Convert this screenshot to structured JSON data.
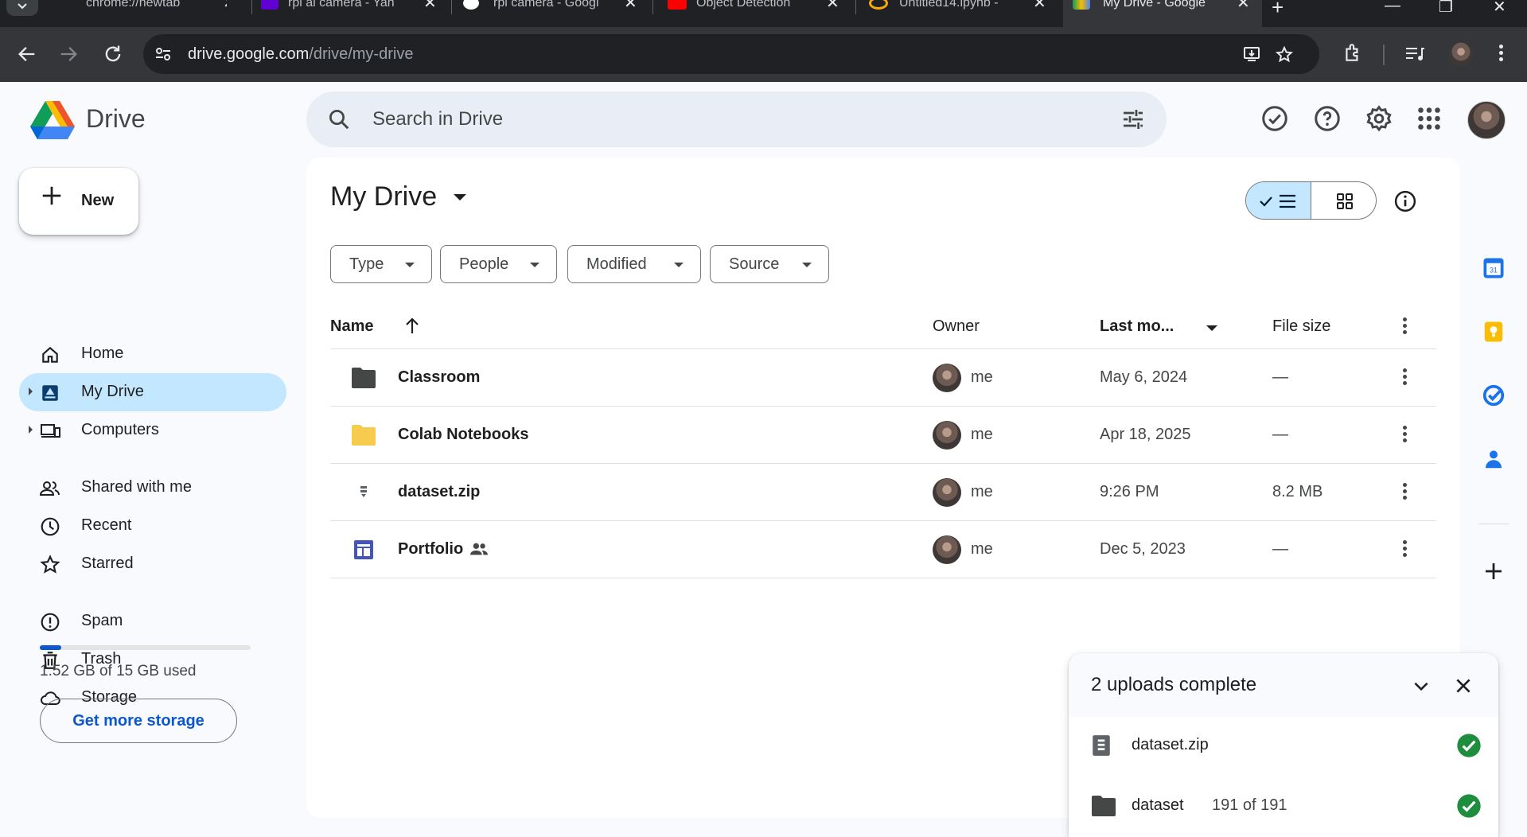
{
  "browser": {
    "tabs": [
      {
        "title": "chrome://newtab"
      },
      {
        "title": "rpi ai camera - Yah"
      },
      {
        "title": "rpi camera - Googl"
      },
      {
        "title": "Object Detection"
      },
      {
        "title": "Untitled14.ipynb -"
      },
      {
        "title": "My Drive - Google"
      }
    ],
    "url_host": "drive.google.com",
    "url_path": "/drive/my-drive"
  },
  "header": {
    "brand": "Drive",
    "search_placeholder": "Search in Drive"
  },
  "sidebar": {
    "new_label": "New",
    "items": [
      {
        "label": "Home",
        "icon": "home-icon"
      },
      {
        "label": "My Drive",
        "icon": "my-drive-icon"
      },
      {
        "label": "Computers",
        "icon": "computers-icon"
      },
      {
        "label": "Shared with me",
        "icon": "shared-icon"
      },
      {
        "label": "Recent",
        "icon": "clock-icon"
      },
      {
        "label": "Starred",
        "icon": "star-icon"
      },
      {
        "label": "Spam",
        "icon": "spam-icon"
      },
      {
        "label": "Trash",
        "icon": "trash-icon"
      },
      {
        "label": "Storage",
        "icon": "cloud-icon"
      }
    ],
    "storage_text": "1.52 GB of 15 GB used",
    "storage_fraction": 0.101,
    "get_more_label": "Get more storage"
  },
  "main": {
    "title": "My Drive",
    "filters": [
      "Type",
      "People",
      "Modified",
      "Source"
    ],
    "columns": {
      "name": "Name",
      "owner": "Owner",
      "modified": "Last mo...",
      "size": "File size"
    },
    "rows": [
      {
        "name": "Classroom",
        "type": "folder-dark",
        "owner": "me",
        "modified": "May 6, 2024",
        "size": "—"
      },
      {
        "name": "Colab Notebooks",
        "type": "folder-yellow",
        "owner": "me",
        "modified": "Apr 18, 2025",
        "size": "—"
      },
      {
        "name": "dataset.zip",
        "type": "zip",
        "owner": "me",
        "modified": "9:26 PM",
        "size": "8.2 MB"
      },
      {
        "name": "Portfolio",
        "type": "sites",
        "owner": "me",
        "modified": "Dec 5, 2023",
        "size": "—"
      }
    ]
  },
  "uploads": {
    "title": "2 uploads complete",
    "items": [
      {
        "name": "dataset.zip",
        "count": ""
      },
      {
        "name": "dataset",
        "count": "191 of 191"
      }
    ]
  },
  "colors": {
    "accent": "#0b57d0",
    "selected": "#c2e7ff",
    "success": "#1e8e3e"
  }
}
